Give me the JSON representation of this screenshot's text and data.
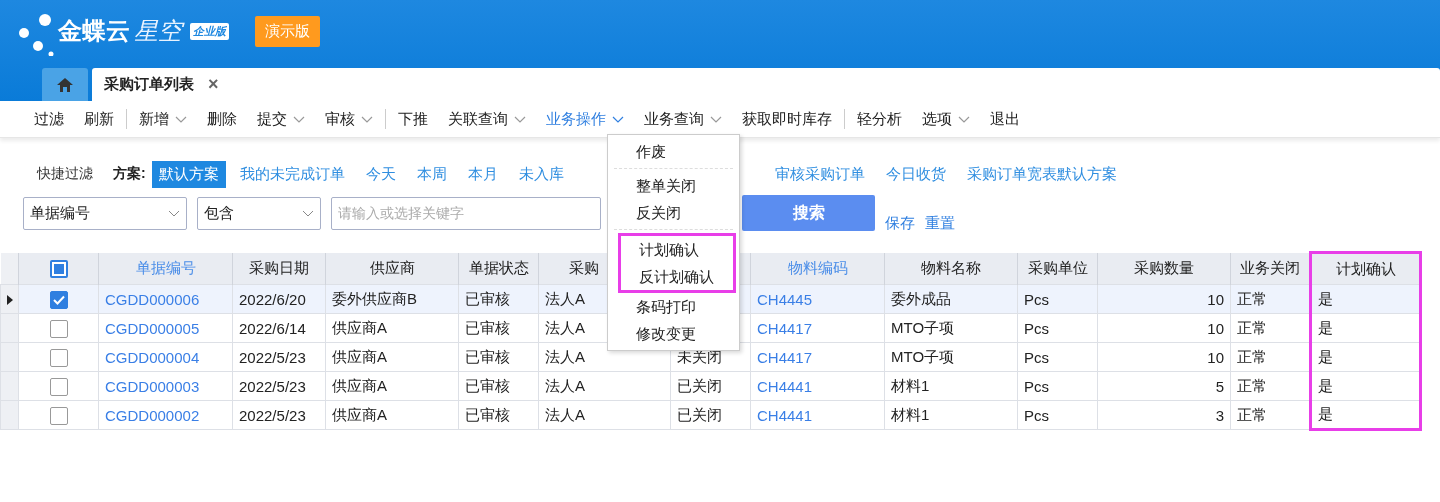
{
  "header": {
    "brand": "金蝶云",
    "product": "星空",
    "edition": "企业版",
    "demo_badge": "演示版"
  },
  "tabs": [
    {
      "kind": "home",
      "selected": false
    },
    {
      "kind": "page",
      "label": "采购订单列表",
      "close": "×",
      "selected": true
    }
  ],
  "toolbar": [
    [
      {
        "label": "过滤",
        "dropdown": false,
        "selected": false
      },
      {
        "label": "刷新",
        "dropdown": false,
        "selected": false
      }
    ],
    [
      {
        "label": "新增",
        "dropdown": true,
        "selected": false
      },
      {
        "label": "删除",
        "dropdown": false,
        "selected": false
      },
      {
        "label": "提交",
        "dropdown": true,
        "selected": false
      },
      {
        "label": "审核",
        "dropdown": true,
        "selected": false
      }
    ],
    [
      {
        "label": "下推",
        "dropdown": false,
        "selected": false
      },
      {
        "label": "关联查询",
        "dropdown": true,
        "selected": false
      },
      {
        "label": "业务操作",
        "dropdown": true,
        "selected": true
      },
      {
        "label": "业务查询",
        "dropdown": true,
        "selected": false
      },
      {
        "label": "获取即时库存",
        "dropdown": false,
        "selected": false
      }
    ],
    [
      {
        "label": "轻分析",
        "dropdown": false,
        "selected": false
      },
      {
        "label": "选项",
        "dropdown": true,
        "selected": false
      },
      {
        "label": "退出",
        "dropdown": false,
        "selected": false
      }
    ]
  ],
  "dropdown_menu": [
    {
      "kind": "item",
      "label": "作废",
      "highlighted": false
    },
    {
      "kind": "separator"
    },
    {
      "kind": "item",
      "label": "整单关闭",
      "highlighted": false
    },
    {
      "kind": "item",
      "label": "反关闭",
      "highlighted": false
    },
    {
      "kind": "separator"
    },
    {
      "kind": "item",
      "label": "计划确认",
      "highlighted": true
    },
    {
      "kind": "item",
      "label": "反计划确认",
      "highlighted": true
    },
    {
      "kind": "item",
      "label": "条码打印",
      "highlighted": false
    },
    {
      "kind": "item",
      "label": "修改变更",
      "highlighted": false
    }
  ],
  "quick_filter": {
    "label": "快捷过滤",
    "scheme_label": "方案:",
    "schemes": [
      {
        "label": "默认方案",
        "selected": true
      },
      {
        "label": "我的未完成订单",
        "selected": false
      },
      {
        "label": "今天",
        "selected": false
      },
      {
        "label": "本周",
        "selected": false
      },
      {
        "label": "本月",
        "selected": false
      },
      {
        "label": "未入库",
        "selected": false
      },
      {
        "label": "审核采购订单",
        "selected": false
      },
      {
        "label": "今日收货",
        "selected": false
      },
      {
        "label": "采购订单宽表默认方案",
        "selected": false
      }
    ]
  },
  "search": {
    "field": "单据编号",
    "operator": "包含",
    "placeholder": "请输入或选择关键字",
    "button": "搜索",
    "save": "保存",
    "reset": "重置"
  },
  "table": {
    "columns": [
      {
        "label": "单据编号",
        "link": true,
        "highlighted": false
      },
      {
        "label": "采购日期",
        "link": false,
        "highlighted": false
      },
      {
        "label": "供应商",
        "link": false,
        "highlighted": false
      },
      {
        "label": "单据状态",
        "link": false,
        "highlighted": false
      },
      {
        "label": "采购",
        "link": false,
        "highlighted": false
      },
      {
        "link": false,
        "highlighted": false
      },
      {
        "label": "物料编码",
        "link": true,
        "highlighted": false
      },
      {
        "label": "物料名称",
        "link": false,
        "highlighted": false
      },
      {
        "label": "采购单位",
        "link": false,
        "highlighted": false
      },
      {
        "label": "采购数量",
        "link": false,
        "highlighted": false
      },
      {
        "label": "业务关闭",
        "link": false,
        "highlighted": false
      },
      {
        "label": "计划确认",
        "link": false,
        "highlighted": true
      }
    ],
    "select_all_partial": true,
    "rows": [
      {
        "current": true,
        "checked": true,
        "cells": [
          "CGDD000006",
          "2022/6/20",
          "委外供应商B",
          "已审核",
          "法人A",
          "",
          "CH4445",
          "委外成品",
          "Pcs",
          "10",
          "正常",
          "是"
        ]
      },
      {
        "current": false,
        "checked": false,
        "cells": [
          "CGDD000005",
          "2022/6/14",
          "供应商A",
          "已审核",
          "法人A",
          "",
          "CH4417",
          "MTO子项",
          "Pcs",
          "10",
          "正常",
          "是"
        ]
      },
      {
        "current": false,
        "checked": false,
        "cells": [
          "CGDD000004",
          "2022/5/23",
          "供应商A",
          "已审核",
          "法人A",
          "未关闭",
          "CH4417",
          "MTO子项",
          "Pcs",
          "10",
          "正常",
          "是"
        ]
      },
      {
        "current": false,
        "checked": false,
        "cells": [
          "CGDD000003",
          "2022/5/23",
          "供应商A",
          "已审核",
          "法人A",
          "已关闭",
          "CH4441",
          "材料1",
          "Pcs",
          "5",
          "正常",
          "是"
        ]
      },
      {
        "current": false,
        "checked": false,
        "cells": [
          "CGDD000002",
          "2022/5/23",
          "供应商A",
          "已审核",
          "法人A",
          "已关闭",
          "CH4441",
          "材料1",
          "Pcs",
          "3",
          "正常",
          "是"
        ]
      }
    ]
  }
}
